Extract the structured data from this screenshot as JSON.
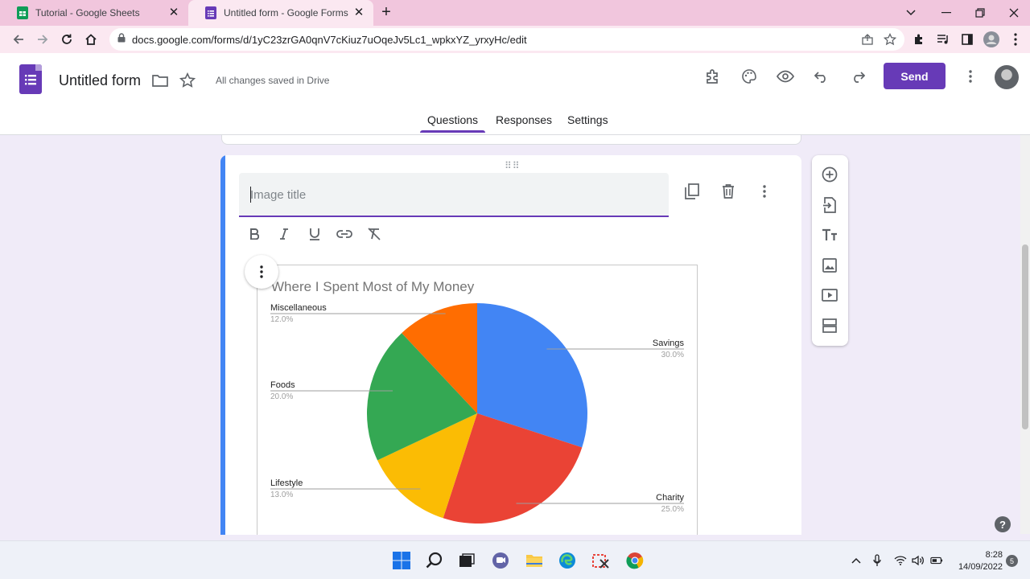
{
  "browser": {
    "tabs": [
      {
        "title": "Tutorial - Google Sheets",
        "favicon": "sheets-icon",
        "color": "#0f9d58"
      },
      {
        "title": "Untitled form - Google Forms",
        "favicon": "forms-icon",
        "color": "#673ab7"
      }
    ],
    "close_glyph": "✕",
    "new_tab_glyph": "+",
    "url": "docs.google.com/forms/d/1yC23zrGA0qnV7cKiuz7uOqeJv5Lc1_wpkxYZ_yrxyHc/edit"
  },
  "forms": {
    "title": "Untitled form",
    "save_status": "All changes saved in Drive",
    "send_label": "Send",
    "accent_color": "#673ab7",
    "tabs": [
      {
        "label": "Questions",
        "active": true
      },
      {
        "label": "Responses",
        "active": false
      },
      {
        "label": "Settings",
        "active": false
      }
    ]
  },
  "item": {
    "title_placeholder": "Image title",
    "title_value": "",
    "drag_glyph": "⠿⠿"
  },
  "chart_data": {
    "type": "pie",
    "title": "Where I Spent Most of My Money",
    "slices": [
      {
        "label": "Savings",
        "value": 30.0,
        "pct_label": "30.0%",
        "color": "#4285f4"
      },
      {
        "label": "Charity",
        "value": 25.0,
        "pct_label": "25.0%",
        "color": "#ea4335"
      },
      {
        "label": "Lifestyle",
        "value": 13.0,
        "pct_label": "13.0%",
        "color": "#fbbc04"
      },
      {
        "label": "Foods",
        "value": 20.0,
        "pct_label": "20.0%",
        "color": "#34a853"
      },
      {
        "label": "Miscellaneous",
        "value": 12.0,
        "pct_label": "12.0%",
        "color": "#ff6d01"
      }
    ],
    "start_angle": "12 o'clock",
    "direction": "clockwise",
    "legend": "labels with leader lines"
  },
  "help": {
    "glyph": "?"
  },
  "taskbar": {
    "time": "8:28",
    "date": "14/09/2022",
    "notifications": "5"
  }
}
